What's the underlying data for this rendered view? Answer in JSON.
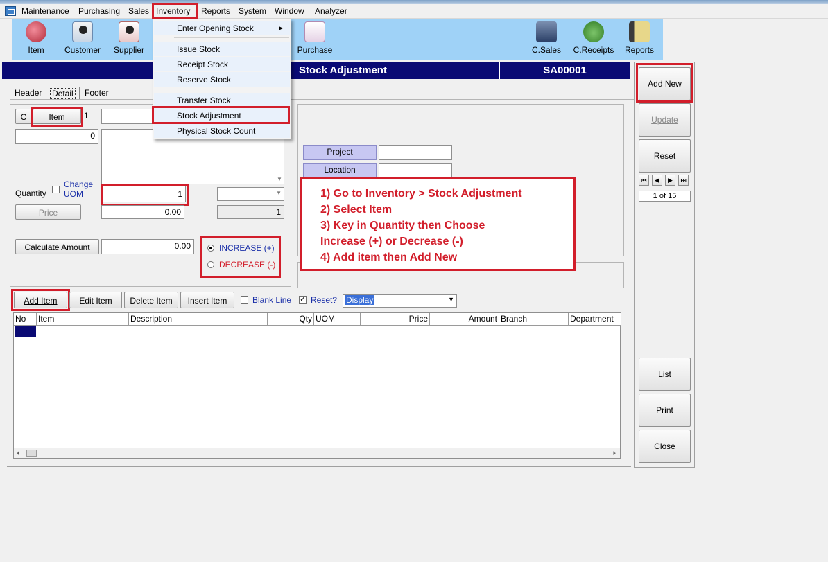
{
  "menu": [
    "Maintenance",
    "Purchasing",
    "Sales",
    "Inventory",
    "Reports",
    "System",
    "Window",
    "Analyzer"
  ],
  "toolbar": {
    "item": "Item",
    "customer": "Customer",
    "supplier": "Supplier",
    "purchase": "Purchase",
    "csales": "C.Sales",
    "creceipts": "C.Receipts",
    "reports": "Reports"
  },
  "inventory_menu": {
    "enter_opening_stock": "Enter Opening Stock",
    "submenu_arrow": "▸",
    "issue_stock": "Issue Stock",
    "receipt_stock": "Receipt Stock",
    "reserve_stock": "Reserve Stock",
    "transfer_stock": "Transfer Stock",
    "stock_adjustment": "Stock Adjustment",
    "physical_stock_count": "Physical Stock Count"
  },
  "header": {
    "title": "Stock Adjustment",
    "doc_no": "SA00001"
  },
  "tabs": [
    "Header",
    "Detail",
    "Footer"
  ],
  "detail": {
    "c_button": "C",
    "item_button": "Item",
    "item_seq": "1",
    "code_field": "0",
    "quantity_label": "Quantity",
    "change_uom": "Change UOM",
    "quantity_value": "1",
    "uom_rate": "1",
    "price_button": "Price",
    "price_value": "0.00",
    "calc_button": "Calculate Amount",
    "amount_value": "0.00",
    "increase": "INCREASE (+)",
    "decrease": "DECREASE (-)"
  },
  "right_panel": {
    "project": "Project",
    "location": "Location"
  },
  "note": {
    "line1": "1) Go to Inventory > Stock Adjustment",
    "line2": "2) Select Item",
    "line3": "3) Key in Quantity then Choose",
    "line4": "Increase (+) or Decrease (-)",
    "line5": "4) Add item then Add New"
  },
  "item_toolbar": {
    "add_item": "Add Item",
    "edit_item": "Edit Item",
    "delete_item": "Delete Item",
    "insert_item": "Insert Item",
    "blank_line": "Blank Line",
    "reset": "Reset?",
    "display": "Display"
  },
  "grid": {
    "columns": [
      "No",
      "Item",
      "Description",
      "Qty",
      "UOM",
      "Price",
      "Amount",
      "Branch",
      "Department"
    ]
  },
  "side": {
    "add_new": "Add New",
    "update": "Update",
    "reset": "Reset",
    "record": "1 of 15",
    "list": "List",
    "print": "Print",
    "close": "Close"
  },
  "colors": {
    "accent_red": "#d21e2b",
    "header_navy": "#0a0a74",
    "toolbar_blue": "#9fd2f7"
  }
}
